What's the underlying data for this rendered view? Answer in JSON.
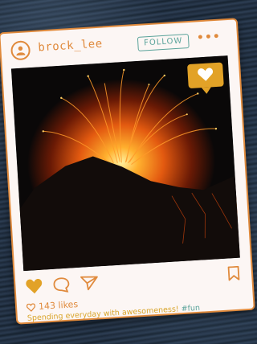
{
  "post": {
    "username": "brock_lee",
    "follow_label": "FOLLOW",
    "more_label": "•••",
    "likes_count": "143 likes",
    "caption_text": "Spending everyday with awesomeness! ",
    "hashtag": "#fun"
  },
  "icons": {
    "avatar": "user-icon",
    "like_badge": "heart-icon",
    "like": "heart-filled-icon",
    "comment": "speech-bubble-icon",
    "share": "paper-plane-icon",
    "save": "bookmark-icon"
  },
  "colors": {
    "accent": "#e08a3c",
    "teal": "#5aa39a",
    "gold": "#e2a227",
    "frame_bg": "#fcf6f4"
  }
}
